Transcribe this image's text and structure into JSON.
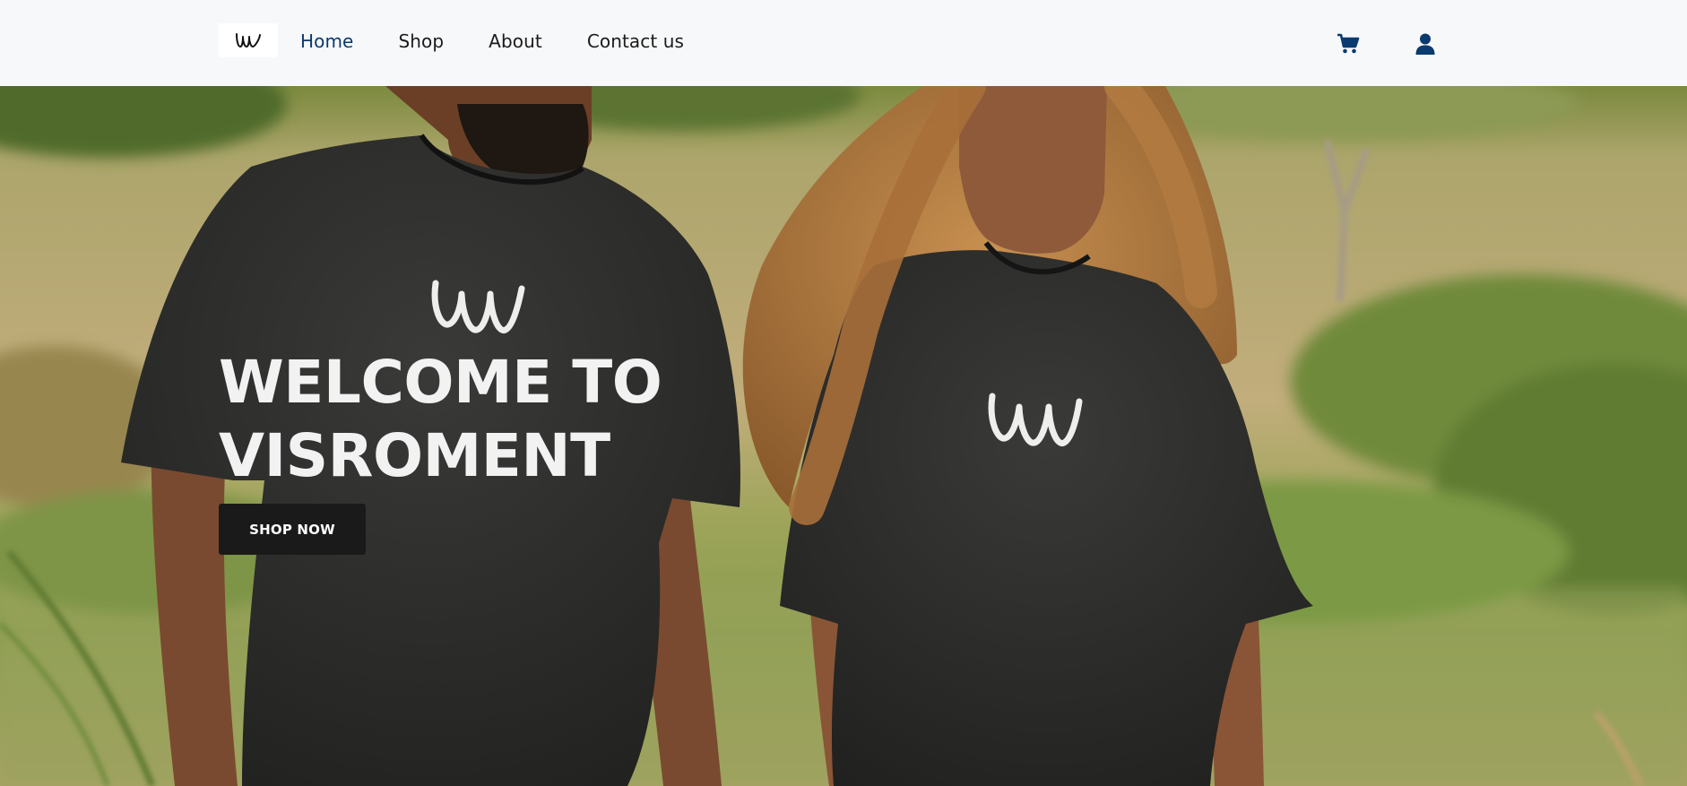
{
  "nav": {
    "logo_icon": "vvv-logo-icon",
    "links": [
      {
        "label": "Home",
        "active": true
      },
      {
        "label": "Shop",
        "active": false
      },
      {
        "label": "About",
        "active": false
      },
      {
        "label": "Contact us",
        "active": false
      }
    ],
    "cart_icon": "cart-icon",
    "user_icon": "user-icon",
    "accent_color": "#0b3a6e"
  },
  "hero": {
    "title_line1": "WELCOME TO",
    "title_line2": "VISROMENT",
    "button_label": "SHOP NOW",
    "button_color": "#1a1a1a",
    "background_description_icon": "hero-photo"
  }
}
